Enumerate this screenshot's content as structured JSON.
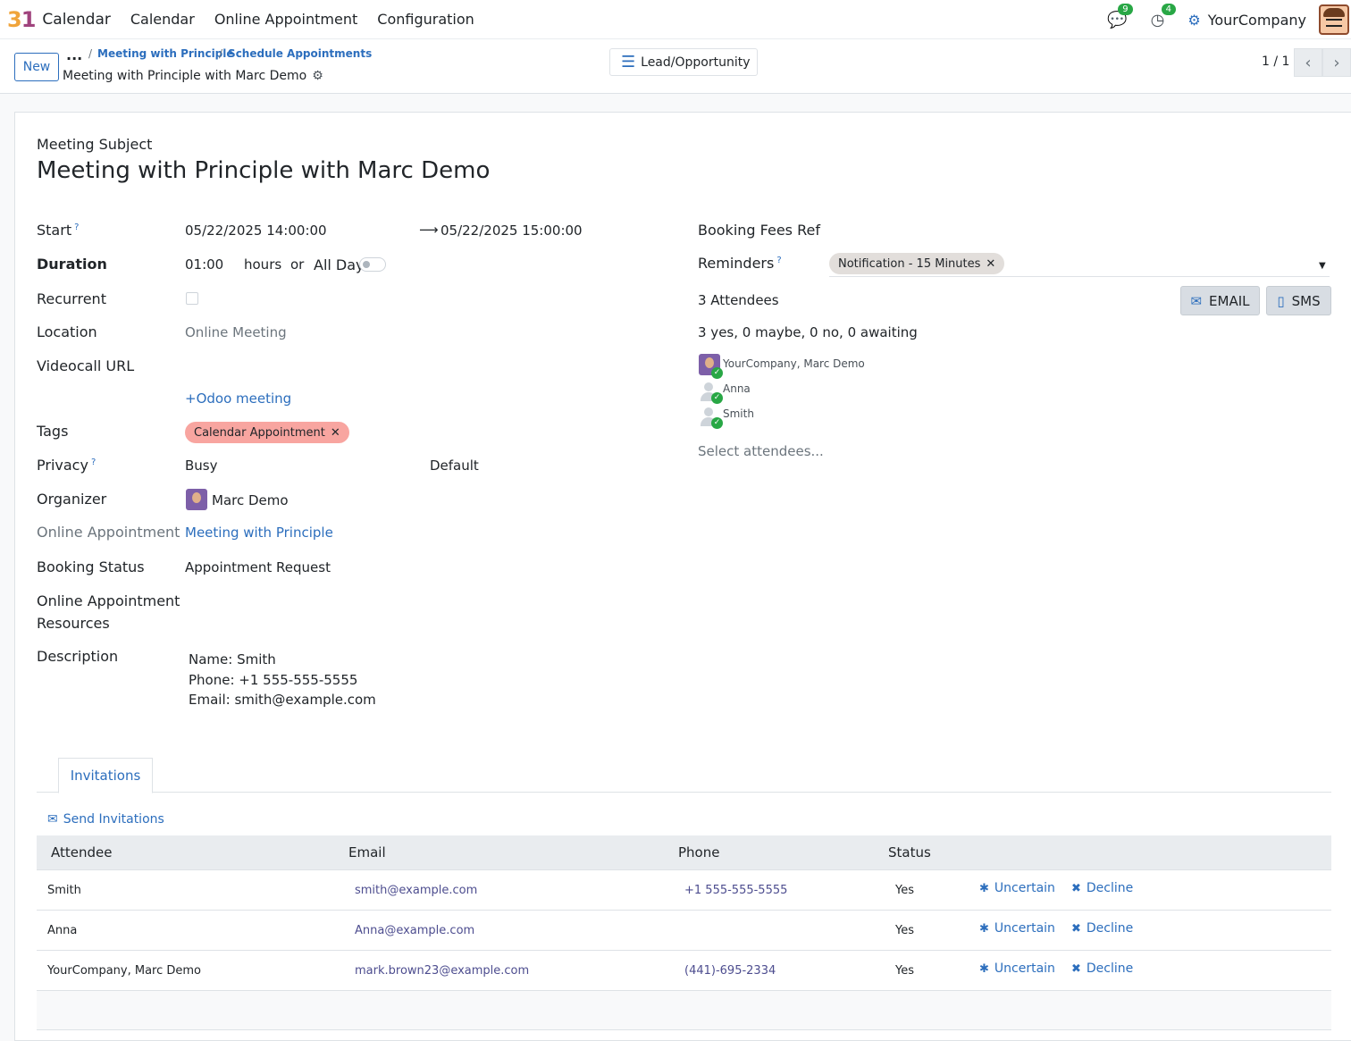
{
  "navbar": {
    "app_logo": "31",
    "app_name": "Calendar",
    "menu": [
      "Calendar",
      "Online Appointment",
      "Configuration"
    ],
    "messages_count": "9",
    "activities_count": "4",
    "company": "YourCompany"
  },
  "control_panel": {
    "new_label": "New",
    "breadcrumb_dots": "...",
    "breadcrumbs": [
      "Meeting with Principle",
      "Schedule Appointments"
    ],
    "record_title": "Meeting with Principle with Marc Demo",
    "smart_button": "Lead/Opportunity",
    "pager": "1 / 1"
  },
  "form": {
    "subject_label": "Meeting Subject",
    "subject": "Meeting with Principle with Marc Demo",
    "start_label": "Start",
    "start_value": "05/22/2025 14:00:00",
    "stop_value": "05/22/2025 15:00:00",
    "duration_label": "Duration",
    "duration_value": "01:00",
    "hours_label": "hours",
    "or_label": "or",
    "allday_label": "All Day",
    "recurrent_label": "Recurrent",
    "location_label": "Location",
    "location_value": "Online Meeting",
    "videocall_label": "Videocall URL",
    "odoo_meeting": "Odoo meeting",
    "tags_label": "Tags",
    "tag": "Calendar Appointment",
    "privacy_label": "Privacy",
    "privacy_busy": "Busy",
    "privacy_default": "Default",
    "organizer_label": "Organizer",
    "organizer": "Marc Demo",
    "online_appt_label": "Online Appointment",
    "online_appt_value": "Meeting with Principle",
    "booking_status_label": "Booking Status",
    "booking_status_value": "Appointment Request",
    "resources_label_1": "Online Appointment",
    "resources_label_2": "Resources",
    "description_label": "Description",
    "description_lines": [
      "Name: Smith",
      "Phone: +1 555-555-5555",
      "Email: smith@example.com"
    ],
    "booking_fees_label": "Booking Fees Ref",
    "reminders_label": "Reminders",
    "reminder_tag": "Notification - 15 Minutes",
    "attendees_count": "3 Attendees",
    "email_btn": "EMAIL",
    "sms_btn": "SMS",
    "attendees_summary": "3 yes, 0 maybe, 0 no, 0 awaiting",
    "attendees": [
      "YourCompany, Marc Demo",
      "Anna",
      "Smith"
    ],
    "select_attendees": "Select attendees..."
  },
  "invitations": {
    "tab": "Invitations",
    "send_label": "Send Invitations",
    "columns": [
      "Attendee",
      "Email",
      "Phone",
      "Status"
    ],
    "rows": [
      {
        "attendee": "Smith",
        "email": "smith@example.com",
        "phone": "+1 555-555-5555",
        "status": "Yes"
      },
      {
        "attendee": "Anna",
        "email": "Anna@example.com",
        "phone": "",
        "status": "Yes"
      },
      {
        "attendee": "YourCompany, Marc Demo",
        "email": "mark.brown23@example.com",
        "phone": "(441)-695-2334",
        "status": "Yes"
      }
    ],
    "uncertain_label": "Uncertain",
    "decline_label": "Decline"
  },
  "colors": {
    "accent": "#2c6ebd",
    "tag_red": "#f8a5a0",
    "success": "#28a745"
  }
}
